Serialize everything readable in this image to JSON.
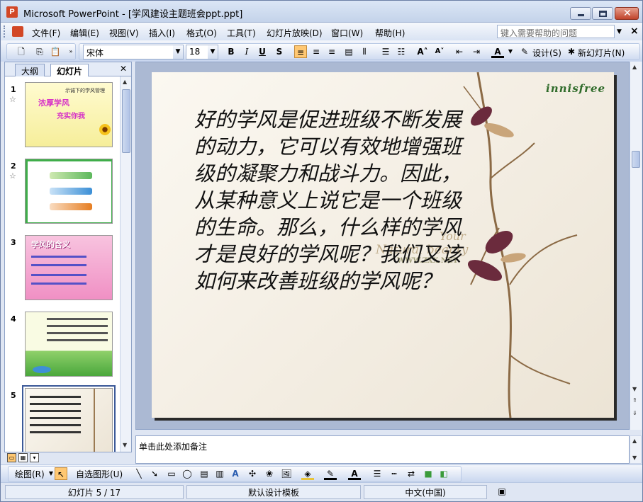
{
  "window": {
    "title": "Microsoft PowerPoint - [学风建设主题班会ppt.ppt]"
  },
  "menu": {
    "items": [
      "文件(F)",
      "编辑(E)",
      "视图(V)",
      "插入(I)",
      "格式(O)",
      "工具(T)",
      "幻灯片放映(D)",
      "窗口(W)",
      "帮助(H)"
    ],
    "help_placeholder": "键入需要帮助的问题"
  },
  "format_toolbar": {
    "font_name": "宋体",
    "font_size": "18",
    "design_label": "设计(S)",
    "new_slide_label": "新幻灯片(N)"
  },
  "left_pane": {
    "tabs": [
      "大纲",
      "幻灯片"
    ],
    "active_tab": "幻灯片",
    "slides": [
      {
        "number": "1",
        "title_line1": "浓厚学风",
        "title_line2": "充实你我",
        "header": "示诚下的学风管理"
      },
      {
        "number": "2"
      },
      {
        "number": "3",
        "title": "学风的含义"
      },
      {
        "number": "4"
      },
      {
        "number": "5"
      }
    ]
  },
  "slide": {
    "body_text": "好的学风是促进班级不断发展的动力，它可以有效地增强班级的凝聚力和战斗力。因此，从某种意义上说它是一个班级的生命。那么，什么样的学风才是良好的学风呢？我们又该如何来改善班级的学风呢？",
    "brand": "innisfree",
    "watermark_line1": "Your",
    "watermark_line2": "Natural beauty",
    "watermark_line3": "WWW.ZXX.NET"
  },
  "notes": {
    "placeholder": "单击此处添加备注"
  },
  "draw_toolbar": {
    "draw_label": "绘图(R)",
    "autoshape_label": "自选图形(U)"
  },
  "status": {
    "slide_position": "幻灯片 5 / 17",
    "template": "默认设计模板",
    "language": "中文(中国)"
  },
  "colors": {
    "accent": "#ffc873",
    "title_bg": "#c4d3ea",
    "brand_green": "#2f6b2a",
    "slide_area_bg": "#abb9d3"
  }
}
